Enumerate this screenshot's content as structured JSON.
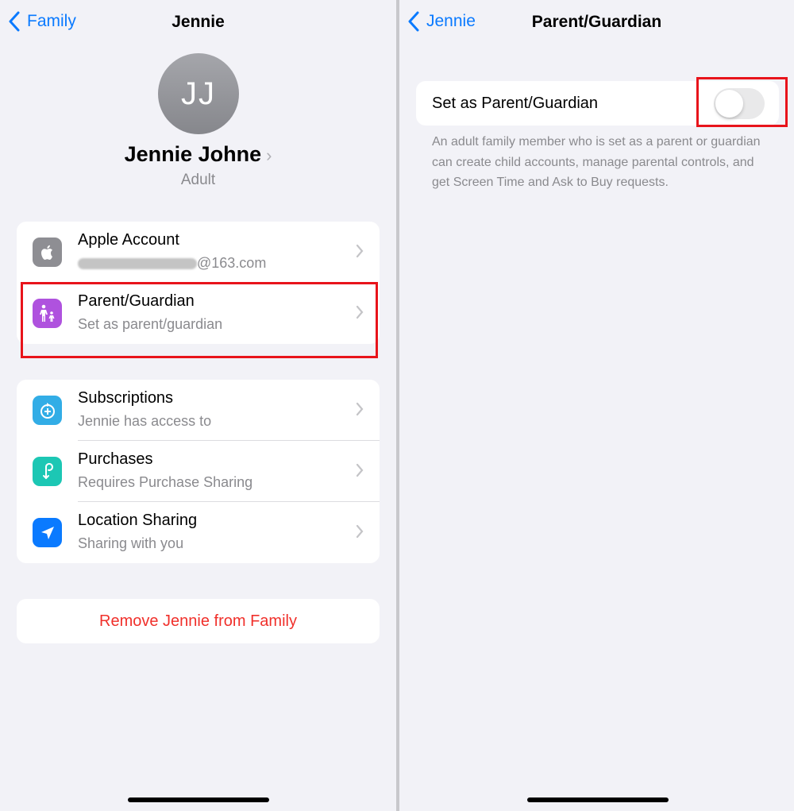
{
  "left": {
    "back_label": "Family",
    "title": "Jennie",
    "avatar_initials": "JJ",
    "name": "Jennie Johne",
    "role": "Adult",
    "account": {
      "title": "Apple Account",
      "email_visible": "@163.com"
    },
    "parent_guardian": {
      "title": "Parent/Guardian",
      "subtitle": "Set as parent/guardian"
    },
    "items": [
      {
        "title": "Subscriptions",
        "subtitle": "Jennie has access to",
        "icon": "subscriptions-icon",
        "color": "#32ade6"
      },
      {
        "title": "Purchases",
        "subtitle": "Requires Purchase Sharing",
        "icon": "purchase-sharing-icon",
        "color": "#1cc7b4"
      },
      {
        "title": "Location Sharing",
        "subtitle": "Sharing with you",
        "icon": "location-arrow-icon",
        "color": "#0a7aff"
      }
    ],
    "remove_label": "Remove Jennie from Family"
  },
  "right": {
    "back_label": "Jennie",
    "title": "Parent/Guardian",
    "toggle_label": "Set as Parent/Guardian",
    "toggle_on": false,
    "footer": "An adult family member who is set as a parent or guardian can create child accounts, manage parental controls, and get Screen Time and Ask to Buy requests."
  },
  "colors": {
    "accent": "#0a7aff",
    "destructive": "#f0302b",
    "highlight": "#e8141b",
    "parent_icon": "#af52de",
    "apple_icon": "#8e8e93"
  }
}
